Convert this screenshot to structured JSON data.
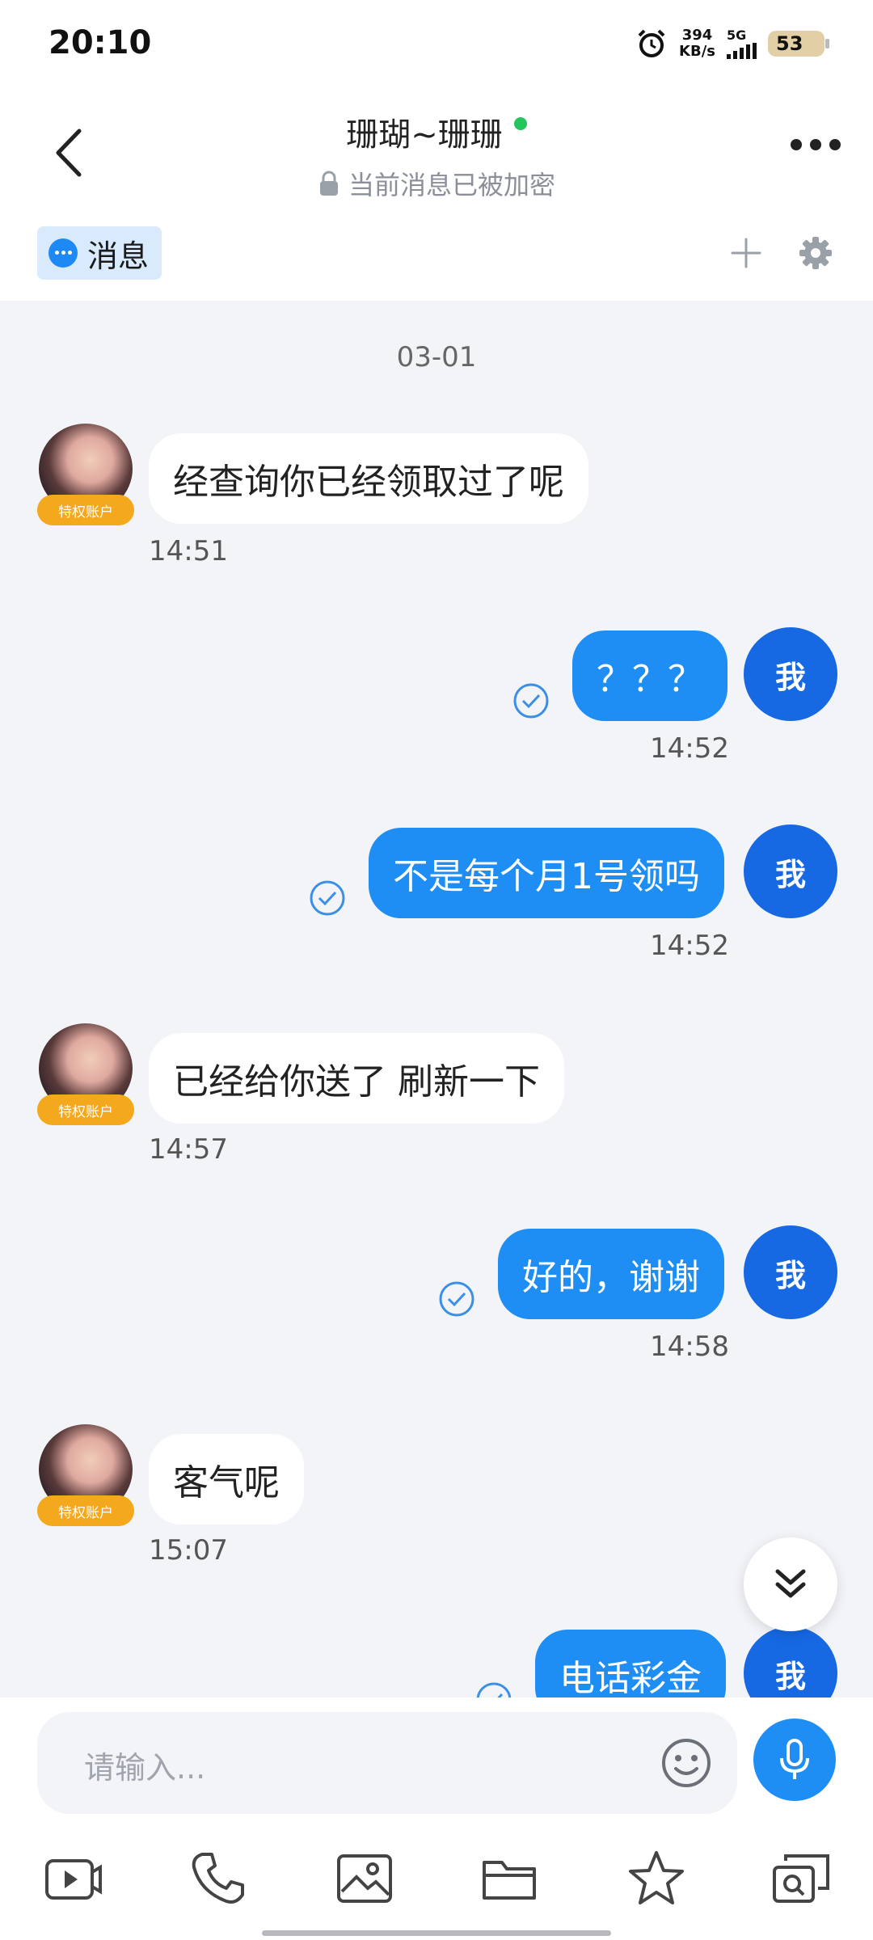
{
  "status_bar": {
    "time": "20:10",
    "speed_value": "394",
    "speed_unit": "KB/s",
    "network": "5G",
    "battery": "53"
  },
  "header": {
    "title": "珊瑚~珊珊",
    "subtitle": "当前消息已被加密"
  },
  "tabs": {
    "active_label": "消息"
  },
  "chat": {
    "date_divider": "03-01",
    "badge_label": "特权账户",
    "me_label": "我",
    "messages": [
      {
        "from": "them",
        "text": "经查询你已经领取过了呢",
        "time": "14:51"
      },
      {
        "from": "me",
        "text": "？？？",
        "time": "14:52"
      },
      {
        "from": "me",
        "text": "不是每个月1号领吗",
        "time": "14:52"
      },
      {
        "from": "them",
        "text": "已经给你送了 刷新一下",
        "time": "14:57"
      },
      {
        "from": "me",
        "text": "好的，谢谢",
        "time": "14:58"
      },
      {
        "from": "them",
        "text": "客气呢",
        "time": "15:07"
      },
      {
        "from": "me",
        "text": "电话彩金",
        "time": ""
      }
    ]
  },
  "input": {
    "placeholder": "请输入..."
  },
  "icons": {
    "accent": "#1e8ef5",
    "me_avatar": "#1668e3",
    "badge": "#f3a81d"
  }
}
